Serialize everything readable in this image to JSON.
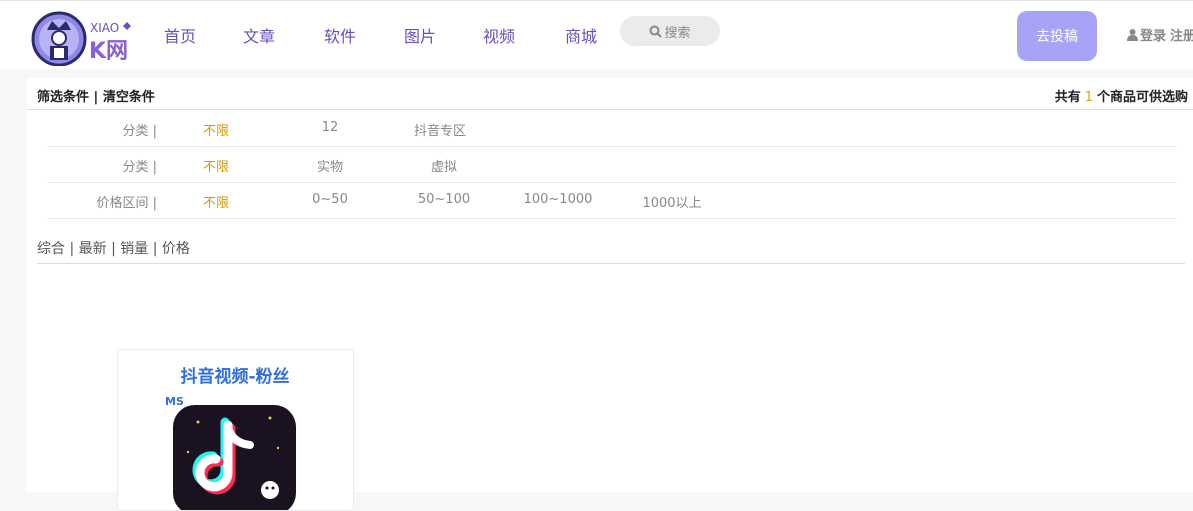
{
  "logo": {
    "text_top": "XIAO",
    "text_main": "K网"
  },
  "nav": [
    "首页",
    "文章",
    "软件",
    "图片",
    "视频",
    "商城"
  ],
  "search": {
    "label": "搜索"
  },
  "submit_button": "去投稿",
  "auth": {
    "login": "登录",
    "register": "注册"
  },
  "filter_bar": {
    "title": "筛选条件",
    "divider": "|",
    "clear": "清空条件",
    "count_prefix": "共有",
    "count": "1",
    "count_suffix": "个商品可供选购"
  },
  "filter_rows": [
    {
      "label": "分类 |",
      "options": [
        "不限",
        "12",
        "抖音专区"
      ]
    },
    {
      "label": "分类 |",
      "options": [
        "不限",
        "实物",
        "虚拟"
      ]
    },
    {
      "label": "价格区间 |",
      "options": [
        "不限",
        "0~50",
        "50~100",
        "100~1000",
        "1000以上"
      ]
    }
  ],
  "sort": [
    "综合",
    "最新",
    "销量",
    "价格"
  ],
  "sort_divider": "|",
  "product": {
    "image_title": "抖音视频-粉丝",
    "image_badge": "MS"
  },
  "colors": {
    "nav": "#6a4fbf",
    "submit_bg": "#a7a4f7",
    "active_option": "#d49a00",
    "count": "#e6a100"
  },
  "icons": [
    "logo-king-icon",
    "search-icon",
    "user-icon",
    "tiktok-note-icon"
  ]
}
